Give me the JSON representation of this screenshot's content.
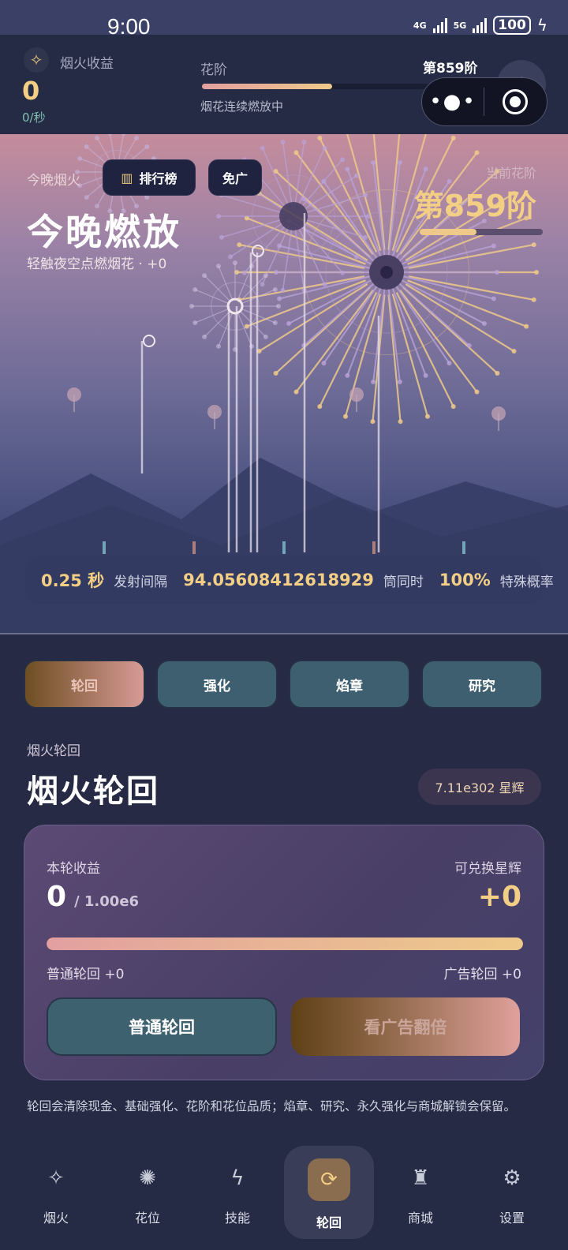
{
  "status_bar": {
    "time": "9:00",
    "net1": "4G",
    "net2": "5G",
    "battery": "100"
  },
  "header": {
    "income_label": "烟火收益",
    "income_value": "0",
    "income_rate": "0/秒",
    "stage_label": "花阶",
    "stage_value": "第859阶",
    "stage_status": "烟花连续燃放中",
    "stage_progress": 0.5
  },
  "sky": {
    "label": "今晚烟火",
    "rank_button": "排行榜",
    "noad_button": "免广",
    "title": "今晚燃放",
    "hint": "轻触夜空点燃烟花 · +0",
    "current_stage_label": "当前花阶",
    "current_stage_value": "第859阶",
    "current_stage_progress": 0.46
  },
  "stats": {
    "interval_value": "0.25 秒",
    "interval_label": "发射间隔",
    "simultaneous_value": "94.05608412618929",
    "simultaneous_label": "筒同时",
    "special_value": "100%",
    "special_label": "特殊概率"
  },
  "tabs": [
    {
      "label": "轮回",
      "active": true
    },
    {
      "label": "强化",
      "active": false
    },
    {
      "label": "焰章",
      "active": false
    },
    {
      "label": "研究",
      "active": false
    }
  ],
  "section": {
    "label": "烟火轮回",
    "title": "烟火轮回",
    "starlight": "7.11e302 星辉"
  },
  "card": {
    "income_label": "本轮收益",
    "exchange_label": "可兑换星辉",
    "income_value": "0",
    "income_target": "/ 1.00e6",
    "exchange_value": "+0",
    "progress": 1.0,
    "normal_reward": "普通轮回 +0",
    "ad_reward": "广告轮回 +0",
    "normal_button": "普通轮回",
    "ad_button": "看广告翻倍"
  },
  "note": "轮回会清除现金、基础强化、花阶和花位品质；焰章、研究、永久强化与商城解锁会保留。",
  "nav": [
    {
      "label": "烟火",
      "icon": "sparkle-icon",
      "glyph": "✧"
    },
    {
      "label": "花位",
      "icon": "flower-icon",
      "glyph": "✺"
    },
    {
      "label": "技能",
      "icon": "lightning-icon",
      "glyph": "ϟ"
    },
    {
      "label": "轮回",
      "icon": "cycle-icon",
      "glyph": "⟳",
      "active": true
    },
    {
      "label": "商城",
      "icon": "lantern-icon",
      "glyph": "♜"
    },
    {
      "label": "设置",
      "icon": "gear-icon",
      "glyph": "⚙"
    }
  ],
  "colors": {
    "gold": "#f2cf85",
    "teal_button": "#3e6170",
    "panel": "#252a45"
  }
}
